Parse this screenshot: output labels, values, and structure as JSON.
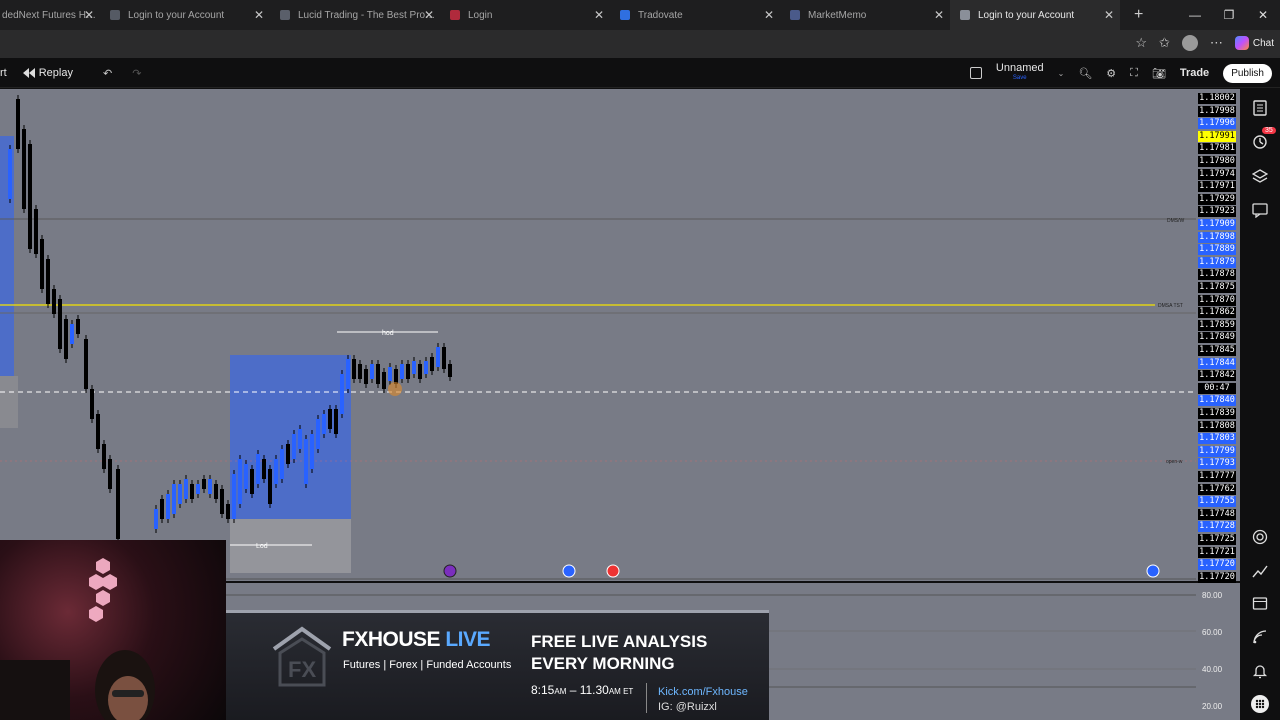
{
  "browser": {
    "tabs": [
      {
        "label": "dedNext Futures Help Center",
        "favicon_color": "#3a7bd5",
        "active": false
      },
      {
        "label": "Login to your Account",
        "favicon_color": "#555a64",
        "active": false
      },
      {
        "label": "Lucid Trading - The Best Prop Firm",
        "favicon_color": "#5a5f6a",
        "active": false
      },
      {
        "label": "Login",
        "favicon_color": "#b02a3c",
        "active": false
      },
      {
        "label": "Tradovate",
        "favicon_color": "#2f6fe0",
        "active": false
      },
      {
        "label": "MarketMemo",
        "favicon_color": "#4a5a8a",
        "active": false
      },
      {
        "label": "Login to your Account",
        "favicon_color": "#8a8f99",
        "active": true
      }
    ],
    "chat_label": "Chat"
  },
  "toolbar": {
    "left_partial": "rt",
    "replay_label": "Replay",
    "layout_name": "Unnamed",
    "save_label": "Save",
    "trade_label": "Trade",
    "publish_label": "Publish"
  },
  "price_scale": {
    "labels": [
      {
        "text": "1.18002",
        "style": "dark"
      },
      {
        "text": "1.17998",
        "style": "dark"
      },
      {
        "text": "1.17996",
        "style": "blue"
      },
      {
        "text": "1.17991",
        "style": "yellow"
      },
      {
        "text": "1.17981",
        "style": "dark"
      },
      {
        "text": "1.17980",
        "style": "dark"
      },
      {
        "text": "1.17974",
        "style": "dark"
      },
      {
        "text": "1.17971",
        "style": "dark"
      },
      {
        "text": "1.17929",
        "style": "dark"
      },
      {
        "text": "1.17923",
        "style": "dark"
      },
      {
        "text": "1.17909",
        "style": "blue"
      },
      {
        "text": "1.17898",
        "style": "blue"
      },
      {
        "text": "1.17889",
        "style": "blue"
      },
      {
        "text": "1.17879",
        "style": "blue"
      },
      {
        "text": "1.17878",
        "style": "dark"
      },
      {
        "text": "1.17875",
        "style": "dark"
      },
      {
        "text": "1.17870",
        "style": "dark"
      },
      {
        "text": "1.17862",
        "style": "dark"
      },
      {
        "text": "1.17859",
        "style": "dark"
      },
      {
        "text": "1.17849",
        "style": "dark"
      },
      {
        "text": "1.17845",
        "style": "dark"
      },
      {
        "text": "1.17844",
        "style": "blue"
      },
      {
        "text": "1.17842",
        "style": "dark"
      },
      {
        "text": "00:47",
        "style": "dark"
      },
      {
        "text": "1.17840",
        "style": "blue"
      },
      {
        "text": "1.17839",
        "style": "dark"
      },
      {
        "text": "1.17808",
        "style": "dark"
      },
      {
        "text": "1.17803",
        "style": "blue"
      },
      {
        "text": "1.17799",
        "style": "blue"
      },
      {
        "text": "1.17793",
        "style": "blue"
      },
      {
        "text": "1.17777",
        "style": "dark"
      },
      {
        "text": "1.17762",
        "style": "dark"
      },
      {
        "text": "1.17755",
        "style": "blue"
      },
      {
        "text": "1.17748",
        "style": "dark"
      },
      {
        "text": "1.17728",
        "style": "blue"
      },
      {
        "text": "1.17725",
        "style": "dark"
      },
      {
        "text": "1.17721",
        "style": "dark"
      },
      {
        "text": "1.17720",
        "style": "blue"
      },
      {
        "text": "1.17720",
        "style": "dark"
      }
    ],
    "osc_ticks": [
      "80.00",
      "60.00",
      "40.00",
      "20.00"
    ]
  },
  "chart_annotations": {
    "hod_label": "hod",
    "lod_label": "Lod",
    "line_label_dms": "DMS/W",
    "line_label_dmsa": "DMSA TST",
    "line_label_open": "open-w"
  },
  "sidebar": {
    "alerts_badge": "35"
  },
  "banner": {
    "brand_main": "FXHOUSE",
    "brand_live": "LIVE",
    "tagline": "Futures | Forex | Funded Accounts",
    "headline_1": "FREE LIVE ANALYSIS",
    "headline_2": "EVERY MORNING",
    "time_start": "8:15",
    "time_start_suffix": "AM",
    "time_end": "11.30",
    "time_end_suffix": "AM ET",
    "link_kick": "Kick.com/Fxhouse",
    "link_ig": "IG: @Ruizxl"
  }
}
